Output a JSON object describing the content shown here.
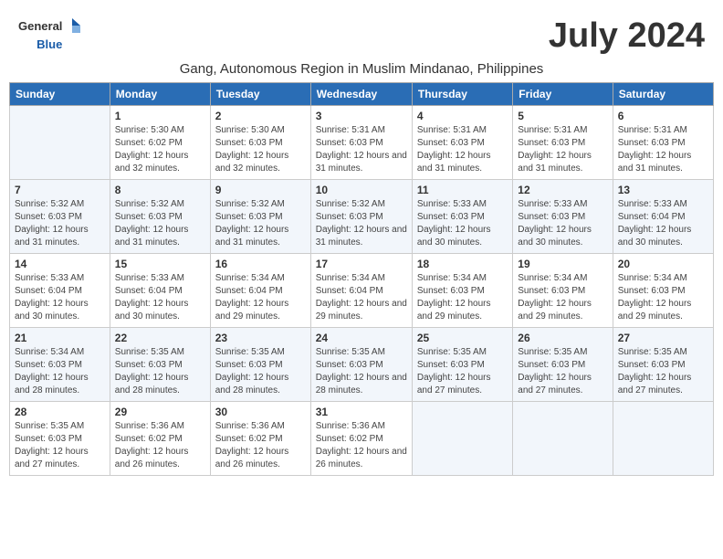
{
  "header": {
    "logo_general": "General",
    "logo_blue": "Blue",
    "month_year": "July 2024",
    "subtitle": "Gang, Autonomous Region in Muslim Mindanao, Philippines"
  },
  "days_of_week": [
    "Sunday",
    "Monday",
    "Tuesday",
    "Wednesday",
    "Thursday",
    "Friday",
    "Saturday"
  ],
  "weeks": [
    [
      {
        "day": "",
        "sunrise": "",
        "sunset": "",
        "daylight": ""
      },
      {
        "day": "1",
        "sunrise": "Sunrise: 5:30 AM",
        "sunset": "Sunset: 6:02 PM",
        "daylight": "Daylight: 12 hours and 32 minutes."
      },
      {
        "day": "2",
        "sunrise": "Sunrise: 5:30 AM",
        "sunset": "Sunset: 6:03 PM",
        "daylight": "Daylight: 12 hours and 32 minutes."
      },
      {
        "day": "3",
        "sunrise": "Sunrise: 5:31 AM",
        "sunset": "Sunset: 6:03 PM",
        "daylight": "Daylight: 12 hours and 31 minutes."
      },
      {
        "day": "4",
        "sunrise": "Sunrise: 5:31 AM",
        "sunset": "Sunset: 6:03 PM",
        "daylight": "Daylight: 12 hours and 31 minutes."
      },
      {
        "day": "5",
        "sunrise": "Sunrise: 5:31 AM",
        "sunset": "Sunset: 6:03 PM",
        "daylight": "Daylight: 12 hours and 31 minutes."
      },
      {
        "day": "6",
        "sunrise": "Sunrise: 5:31 AM",
        "sunset": "Sunset: 6:03 PM",
        "daylight": "Daylight: 12 hours and 31 minutes."
      }
    ],
    [
      {
        "day": "7",
        "sunrise": "Sunrise: 5:32 AM",
        "sunset": "Sunset: 6:03 PM",
        "daylight": "Daylight: 12 hours and 31 minutes."
      },
      {
        "day": "8",
        "sunrise": "Sunrise: 5:32 AM",
        "sunset": "Sunset: 6:03 PM",
        "daylight": "Daylight: 12 hours and 31 minutes."
      },
      {
        "day": "9",
        "sunrise": "Sunrise: 5:32 AM",
        "sunset": "Sunset: 6:03 PM",
        "daylight": "Daylight: 12 hours and 31 minutes."
      },
      {
        "day": "10",
        "sunrise": "Sunrise: 5:32 AM",
        "sunset": "Sunset: 6:03 PM",
        "daylight": "Daylight: 12 hours and 31 minutes."
      },
      {
        "day": "11",
        "sunrise": "Sunrise: 5:33 AM",
        "sunset": "Sunset: 6:03 PM",
        "daylight": "Daylight: 12 hours and 30 minutes."
      },
      {
        "day": "12",
        "sunrise": "Sunrise: 5:33 AM",
        "sunset": "Sunset: 6:03 PM",
        "daylight": "Daylight: 12 hours and 30 minutes."
      },
      {
        "day": "13",
        "sunrise": "Sunrise: 5:33 AM",
        "sunset": "Sunset: 6:04 PM",
        "daylight": "Daylight: 12 hours and 30 minutes."
      }
    ],
    [
      {
        "day": "14",
        "sunrise": "Sunrise: 5:33 AM",
        "sunset": "Sunset: 6:04 PM",
        "daylight": "Daylight: 12 hours and 30 minutes."
      },
      {
        "day": "15",
        "sunrise": "Sunrise: 5:33 AM",
        "sunset": "Sunset: 6:04 PM",
        "daylight": "Daylight: 12 hours and 30 minutes."
      },
      {
        "day": "16",
        "sunrise": "Sunrise: 5:34 AM",
        "sunset": "Sunset: 6:04 PM",
        "daylight": "Daylight: 12 hours and 29 minutes."
      },
      {
        "day": "17",
        "sunrise": "Sunrise: 5:34 AM",
        "sunset": "Sunset: 6:04 PM",
        "daylight": "Daylight: 12 hours and 29 minutes."
      },
      {
        "day": "18",
        "sunrise": "Sunrise: 5:34 AM",
        "sunset": "Sunset: 6:03 PM",
        "daylight": "Daylight: 12 hours and 29 minutes."
      },
      {
        "day": "19",
        "sunrise": "Sunrise: 5:34 AM",
        "sunset": "Sunset: 6:03 PM",
        "daylight": "Daylight: 12 hours and 29 minutes."
      },
      {
        "day": "20",
        "sunrise": "Sunrise: 5:34 AM",
        "sunset": "Sunset: 6:03 PM",
        "daylight": "Daylight: 12 hours and 29 minutes."
      }
    ],
    [
      {
        "day": "21",
        "sunrise": "Sunrise: 5:34 AM",
        "sunset": "Sunset: 6:03 PM",
        "daylight": "Daylight: 12 hours and 28 minutes."
      },
      {
        "day": "22",
        "sunrise": "Sunrise: 5:35 AM",
        "sunset": "Sunset: 6:03 PM",
        "daylight": "Daylight: 12 hours and 28 minutes."
      },
      {
        "day": "23",
        "sunrise": "Sunrise: 5:35 AM",
        "sunset": "Sunset: 6:03 PM",
        "daylight": "Daylight: 12 hours and 28 minutes."
      },
      {
        "day": "24",
        "sunrise": "Sunrise: 5:35 AM",
        "sunset": "Sunset: 6:03 PM",
        "daylight": "Daylight: 12 hours and 28 minutes."
      },
      {
        "day": "25",
        "sunrise": "Sunrise: 5:35 AM",
        "sunset": "Sunset: 6:03 PM",
        "daylight": "Daylight: 12 hours and 27 minutes."
      },
      {
        "day": "26",
        "sunrise": "Sunrise: 5:35 AM",
        "sunset": "Sunset: 6:03 PM",
        "daylight": "Daylight: 12 hours and 27 minutes."
      },
      {
        "day": "27",
        "sunrise": "Sunrise: 5:35 AM",
        "sunset": "Sunset: 6:03 PM",
        "daylight": "Daylight: 12 hours and 27 minutes."
      }
    ],
    [
      {
        "day": "28",
        "sunrise": "Sunrise: 5:35 AM",
        "sunset": "Sunset: 6:03 PM",
        "daylight": "Daylight: 12 hours and 27 minutes."
      },
      {
        "day": "29",
        "sunrise": "Sunrise: 5:36 AM",
        "sunset": "Sunset: 6:02 PM",
        "daylight": "Daylight: 12 hours and 26 minutes."
      },
      {
        "day": "30",
        "sunrise": "Sunrise: 5:36 AM",
        "sunset": "Sunset: 6:02 PM",
        "daylight": "Daylight: 12 hours and 26 minutes."
      },
      {
        "day": "31",
        "sunrise": "Sunrise: 5:36 AM",
        "sunset": "Sunset: 6:02 PM",
        "daylight": "Daylight: 12 hours and 26 minutes."
      },
      {
        "day": "",
        "sunrise": "",
        "sunset": "",
        "daylight": ""
      },
      {
        "day": "",
        "sunrise": "",
        "sunset": "",
        "daylight": ""
      },
      {
        "day": "",
        "sunrise": "",
        "sunset": "",
        "daylight": ""
      }
    ]
  ]
}
